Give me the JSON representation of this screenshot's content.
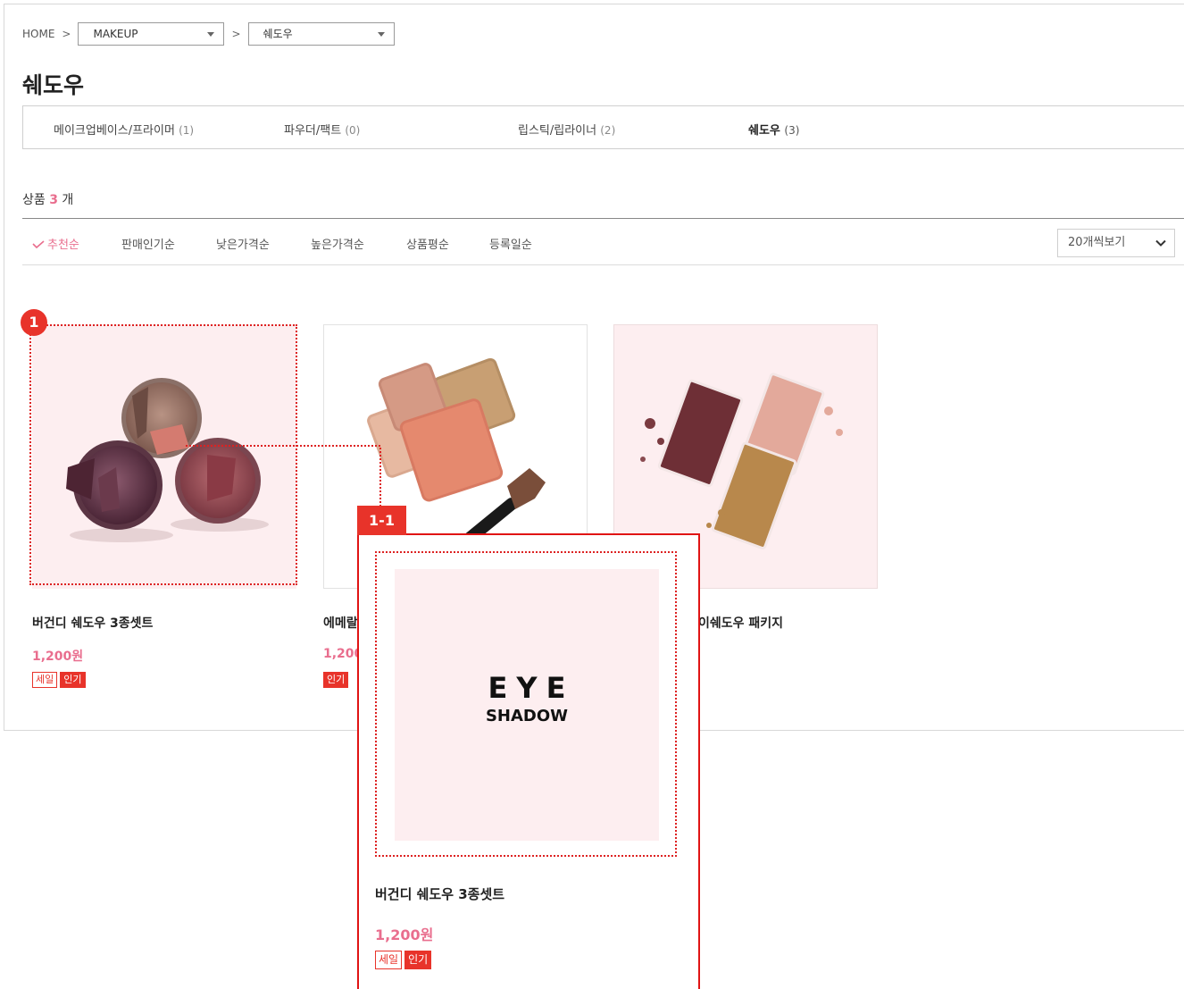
{
  "breadcrumb": {
    "home": "HOME",
    "sep1": ">",
    "category": "MAKEUP",
    "sep2": ">",
    "subcategory": "쉐도우"
  },
  "page_title": "쉐도우",
  "categories": [
    {
      "label": "메이크업베이스/프라이머",
      "count": "(1)"
    },
    {
      "label": "파우더/팩트",
      "count": "(0)"
    },
    {
      "label": "립스틱/립라이너",
      "count": "(2)"
    },
    {
      "label": "쉐도우",
      "count": "(3)"
    }
  ],
  "product_count": {
    "prefix": "상품",
    "number": "3",
    "suffix": "개"
  },
  "sort": {
    "options": [
      "추천순",
      "판매인기순",
      "낮은가격순",
      "높은가격순",
      "상품평순",
      "등록일순"
    ],
    "selected": "추천순",
    "per_page": "20개씩보기"
  },
  "products": [
    {
      "name": "버건디 쉐도우 3종셋트",
      "price": "1,200원",
      "badges": [
        "세일",
        "인기"
      ]
    },
    {
      "name": "에메랄",
      "price": "1,200",
      "badges": [
        "인기"
      ]
    },
    {
      "name": "이쉐도우 패키지",
      "price": "",
      "badges": []
    }
  ],
  "annotations": {
    "marker": "1",
    "popup_tag": "1-1"
  },
  "popup": {
    "placeholder_line1": "EYE",
    "placeholder_line2": "SHADOW",
    "name": "버건디 쉐도우 3종셋트",
    "price": "1,200원",
    "badges": [
      "세일",
      "인기"
    ]
  },
  "colors": {
    "accent_pink": "#e96e8e",
    "badge_red": "#e8332a",
    "annotation_red": "#e01414",
    "image_bg": "#fdeef0"
  }
}
